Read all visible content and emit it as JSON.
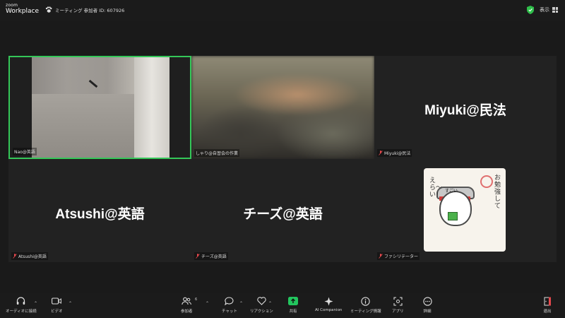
{
  "app": {
    "brand_top": "zoom",
    "brand_bottom": "Workplace",
    "meeting_label": "ミーティング 参加者 ID: 607926",
    "view_label": "表示"
  },
  "tiles": [
    {
      "label": "Nao@英語",
      "active_speaker": true
    },
    {
      "label": "しゃり@自習会の作業"
    },
    {
      "label": "Miyuki@民法",
      "display_name": "Miyuki@民法"
    },
    {
      "label": "Atsushi@英語",
      "display_name": "Atsushi@英語"
    },
    {
      "label": "チーズ@英語",
      "display_name": "チーズ@英語"
    },
    {
      "label": "ファシリテーター"
    }
  ],
  "sticker": {
    "vertical_right": "お勉強して",
    "vertical_left": "えら〜い！",
    "caption": "すごい"
  },
  "toolbar": {
    "audio": "オーディオに接続",
    "video": "ビデオ",
    "participants": "参加者",
    "participants_count": "6",
    "chat": "チャット",
    "reactions": "リアクション",
    "share": "共有",
    "ai": "AI Companion",
    "info": "ミーティング情報",
    "apps": "アプリ",
    "more": "詳細",
    "leave": "退出"
  },
  "colors": {
    "active_border": "#34c758",
    "share_green": "#22c55e",
    "shield_green": "#2fbf4a",
    "leave_red": "#e5484d"
  }
}
